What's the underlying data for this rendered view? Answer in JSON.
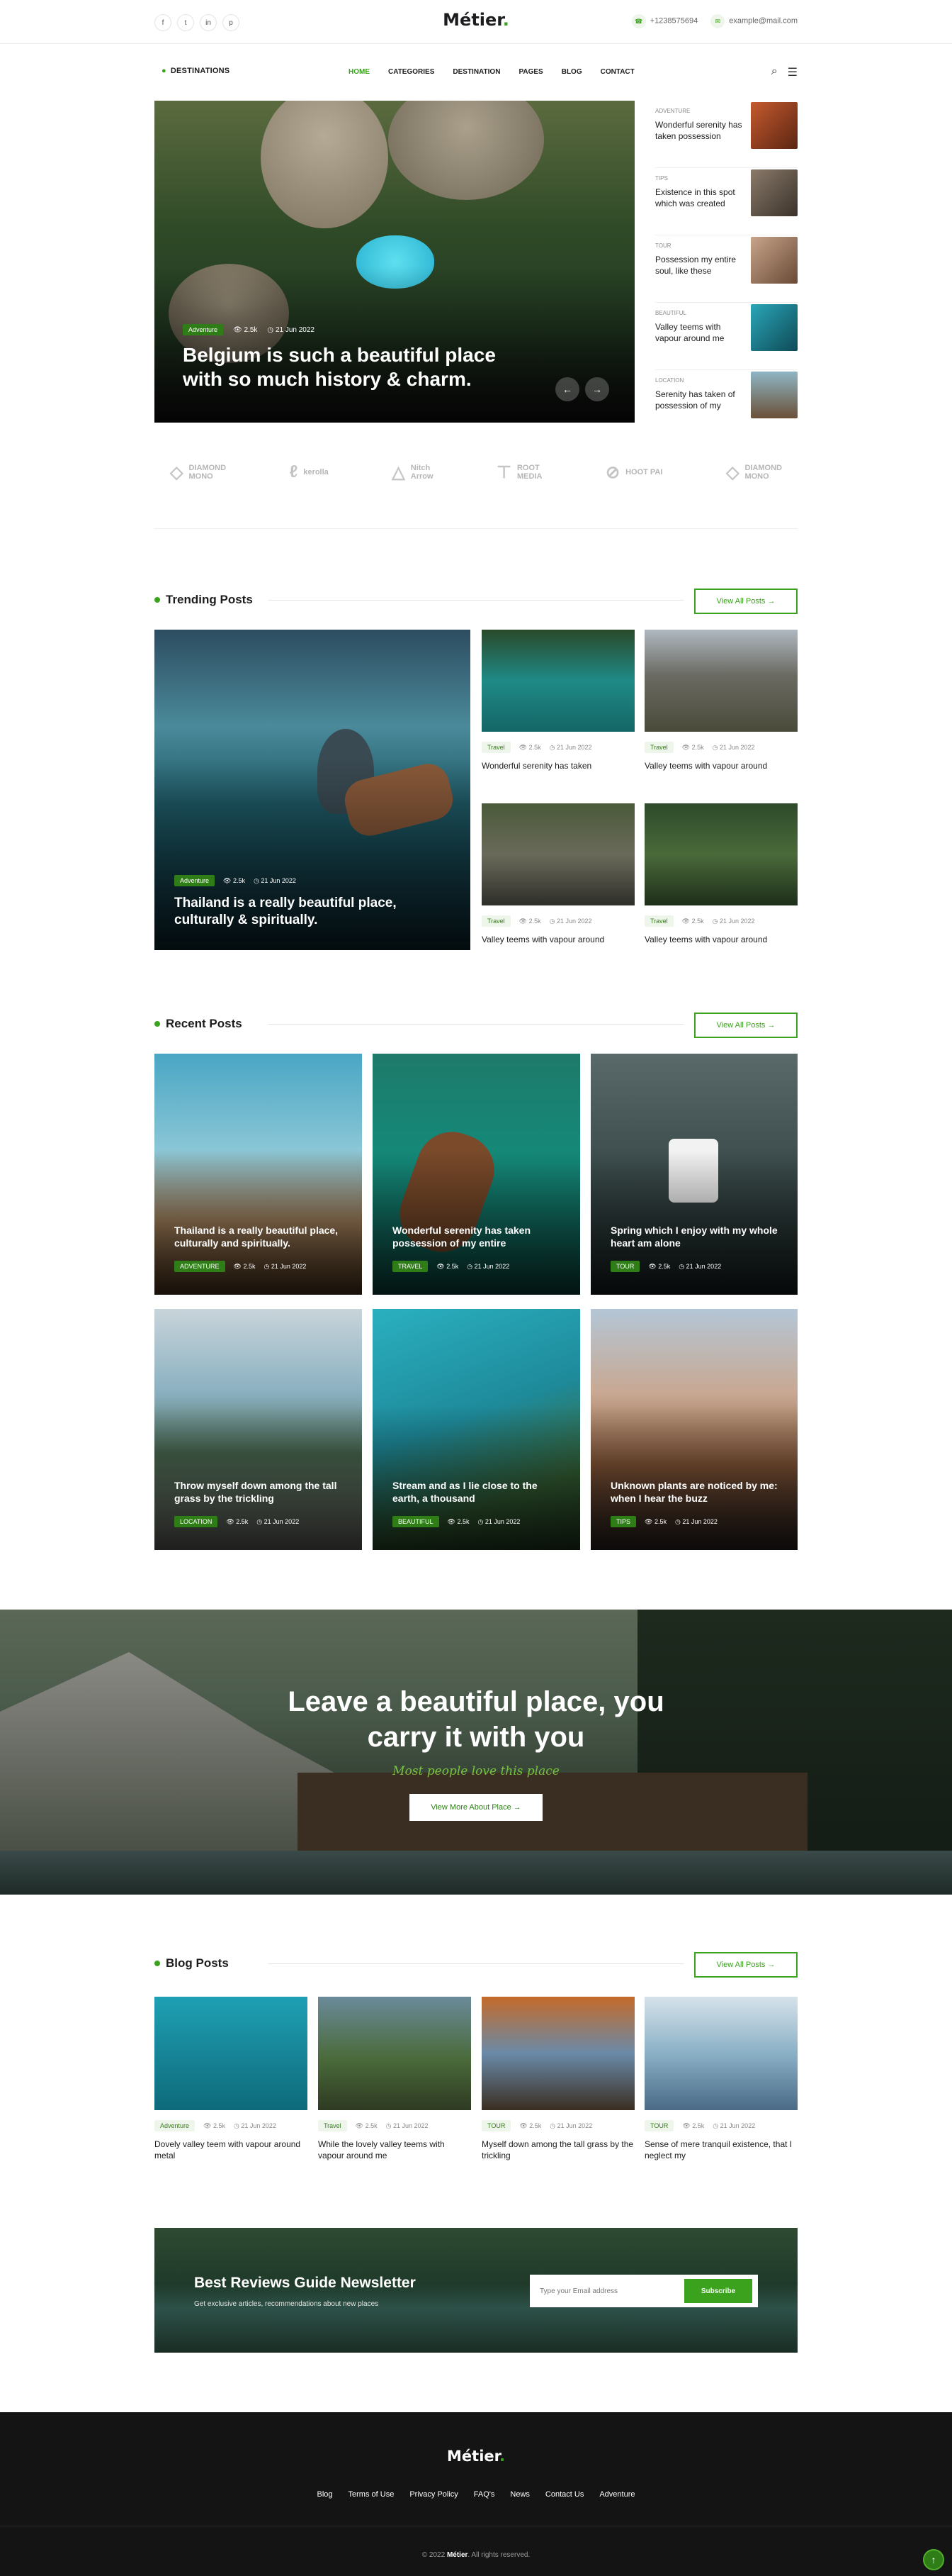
{
  "topbar": {
    "social": [
      "f",
      "t",
      "in",
      "p"
    ],
    "logo": "Métier",
    "logo_dot": ".",
    "phone": "+1238575694",
    "email": "example@mail.com"
  },
  "nav": {
    "destinations": "DESTINATIONS",
    "items": [
      "HOME",
      "CATEGORIES",
      "DESTINATION",
      "PAGES",
      "BLOG",
      "CONTACT"
    ]
  },
  "hero": {
    "badge": "Adventure",
    "views": "2.5k",
    "date": "21 Jun 2022",
    "title": "Belgium is such a beautiful place with so much history & charm."
  },
  "side_posts": [
    {
      "cat": "ADVENTURE",
      "title": "Wonderful serenity has taken possession",
      "color": "#8a3a1e"
    },
    {
      "cat": "TIPS",
      "title": "Existence in this spot which was created",
      "color": "#6a5a4a"
    },
    {
      "cat": "TOUR",
      "title": "Possession my entire soul, like these",
      "color": "#a28068"
    },
    {
      "cat": "BEAUTIFUL",
      "title": "Valley teems with vapour around me",
      "color": "#1e7a8a"
    },
    {
      "cat": "LOCATION",
      "title": "Serenity has taken of possession of my",
      "color": "#5a4a3a"
    }
  ],
  "brands": [
    {
      "icon": "◇",
      "name": "DIAMOND\nMONO"
    },
    {
      "icon": "ℓ",
      "name": "kerolla"
    },
    {
      "icon": "△",
      "name": "Nitch\nArrow"
    },
    {
      "icon": "⊤",
      "name": "ROOT\nMEDIA"
    },
    {
      "icon": "⊘",
      "name": "HOOT PAI"
    },
    {
      "icon": "◇",
      "name": "DIAMOND\nMONO"
    }
  ],
  "trending": {
    "title": "Trending Posts",
    "view_all": "View All Posts",
    "main": {
      "badge": "Adventure",
      "views": "2.5k",
      "date": "21 Jun 2022",
      "title": "Thailand is a really beautiful place, culturally & spiritually."
    },
    "minis": [
      {
        "badge": "Travel",
        "views": "2.5k",
        "date": "21 Jun 2022",
        "title": "Wonderful serenity has taken"
      },
      {
        "badge": "Travel",
        "views": "2.5k",
        "date": "21 Jun 2022",
        "title": "Valley teems with vapour around"
      },
      {
        "badge": "Travel",
        "views": "2.5k",
        "date": "21 Jun 2022",
        "title": "Valley teems with vapour around"
      },
      {
        "badge": "Travel",
        "views": "2.5k",
        "date": "21 Jun 2022",
        "title": "Valley teems with vapour around"
      }
    ]
  },
  "recent": {
    "title": "Recent Posts",
    "view_all": "View All Posts",
    "cards": [
      {
        "badge": "ADVENTURE",
        "views": "2.5k",
        "date": "21 Jun 2022",
        "title": "Thailand is a really beautiful place, culturally and spiritually."
      },
      {
        "badge": "TRAVEL",
        "views": "2.5k",
        "date": "21 Jun 2022",
        "title": "Wonderful serenity has taken possession of my entire"
      },
      {
        "badge": "TOUR",
        "views": "2.5k",
        "date": "21 Jun 2022",
        "title": "Spring which I enjoy with my whole heart am alone"
      },
      {
        "badge": "LOCATION",
        "views": "2.5k",
        "date": "21 Jun 2022",
        "title": "Throw myself down among the tall grass by the trickling"
      },
      {
        "badge": "BEAUTIFUL",
        "views": "2.5k",
        "date": "21 Jun 2022",
        "title": "Stream and as I lie close to the earth, a thousand"
      },
      {
        "badge": "TIPS",
        "views": "2.5k",
        "date": "21 Jun 2022",
        "title": "Unknown plants are noticed by me: when I hear the buzz"
      }
    ]
  },
  "cta": {
    "title": "Leave a beautiful place, you carry it with you",
    "script": "Most people love this place",
    "button": "View More About Place"
  },
  "blog": {
    "title": "Blog Posts",
    "view_all": "View All Posts",
    "posts": [
      {
        "badge": "Adventure",
        "views": "2.5k",
        "date": "21 Jun 2022",
        "title": "Dovely valley teem with vapour around metal"
      },
      {
        "badge": "Travel",
        "views": "2.5k",
        "date": "21 Jun 2022",
        "title": "While the lovely valley teems with vapour around me"
      },
      {
        "badge": "TOUR",
        "views": "2.5k",
        "date": "21 Jun 2022",
        "title": "Myself down among the tall grass by the trickling"
      },
      {
        "badge": "TOUR",
        "views": "2.5k",
        "date": "21 Jun 2022",
        "title": "Sense of mere tranquil existence, that I neglect my"
      }
    ]
  },
  "newsletter": {
    "title": "Best Reviews Guide Newsletter",
    "subtitle": "Get exclusive articles, recommendations about new places",
    "placeholder": "Type your Email address",
    "button": "Subscribe"
  },
  "footer": {
    "logo": "Métier",
    "links": [
      "Blog",
      "Terms of Use",
      "Privacy Policy",
      "FAQ's",
      "News",
      "Contact Us",
      "Adventure"
    ],
    "copy_prefix": "© 2022",
    "copy_brand": "Métier",
    "copy_suffix": ". All rights reserved.",
    "top_icon": "↑"
  },
  "colors": {
    "accent": "#3aa21c",
    "dark": "#141414"
  }
}
